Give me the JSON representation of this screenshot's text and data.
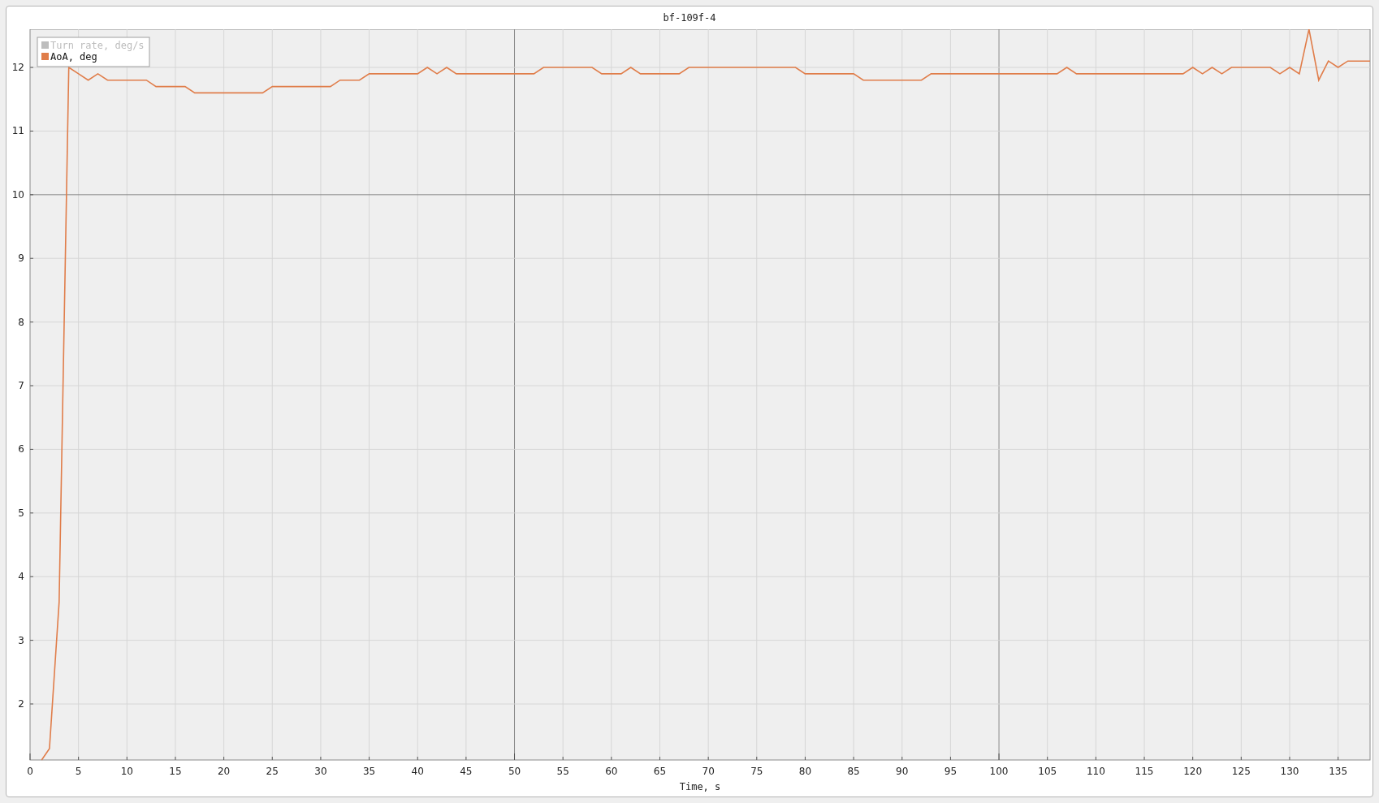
{
  "chart": {
    "chart_data": {
      "type": "line",
      "title": "bf-109f-4",
      "xlabel": "Time, s",
      "x": [
        1.2,
        2,
        3,
        4,
        5,
        6,
        7,
        8,
        12,
        13,
        16,
        17,
        24,
        25,
        31,
        32,
        34,
        35,
        40,
        41,
        42,
        43,
        44,
        52,
        53,
        58,
        59,
        61,
        62,
        63,
        67,
        68,
        79,
        80,
        85,
        86,
        92,
        93,
        106,
        107,
        108,
        119,
        120,
        121,
        122,
        123,
        124,
        128,
        129,
        130,
        131,
        132,
        133,
        134,
        135,
        136,
        138.3
      ],
      "series": [
        {
          "name": "Turn rate, deg/s",
          "color": "#bdbdbd",
          "values": [
            null,
            null,
            null,
            null,
            null,
            null,
            null,
            null,
            null,
            null,
            null,
            null,
            null,
            null,
            null,
            null,
            null,
            null,
            null,
            null,
            null,
            null,
            null,
            null,
            null,
            null,
            null,
            null,
            null,
            null,
            null,
            null,
            null,
            null,
            null,
            null,
            null,
            null,
            null,
            null,
            null,
            null,
            null,
            null,
            null,
            null,
            null,
            null,
            null,
            null,
            null,
            null,
            null,
            null,
            null,
            null,
            null
          ]
        },
        {
          "name": "AoA, deg",
          "color": "#e07d4a",
          "values": [
            1.12,
            1.3,
            3.6,
            12,
            11.9,
            11.8,
            11.9,
            11.8,
            11.8,
            11.7,
            11.7,
            11.6,
            11.6,
            11.7,
            11.7,
            11.8,
            11.8,
            11.9,
            11.9,
            12,
            11.9,
            12,
            11.9,
            11.9,
            12,
            12,
            11.9,
            11.9,
            12,
            11.9,
            11.9,
            12,
            12,
            11.9,
            11.9,
            11.8,
            11.8,
            11.9,
            11.9,
            12,
            11.9,
            11.9,
            12,
            11.9,
            12,
            11.9,
            12,
            12,
            11.9,
            12,
            11.9,
            12.6,
            11.8,
            12.1,
            12,
            12.1,
            12.1
          ]
        }
      ],
      "xlim": [
        0,
        138.3
      ],
      "ylim": [
        1.12,
        12.6
      ],
      "grid": true,
      "xticks": [
        0,
        5,
        10,
        15,
        20,
        25,
        30,
        35,
        40,
        45,
        50,
        55,
        60,
        65,
        70,
        75,
        80,
        85,
        90,
        95,
        100,
        105,
        110,
        115,
        120,
        125,
        130,
        135
      ],
      "yticks": [
        2,
        3,
        4,
        5,
        6,
        7,
        8,
        9,
        10,
        11,
        12
      ]
    },
    "legend": [
      {
        "enabled": false
      },
      {
        "enabled": true
      }
    ]
  }
}
